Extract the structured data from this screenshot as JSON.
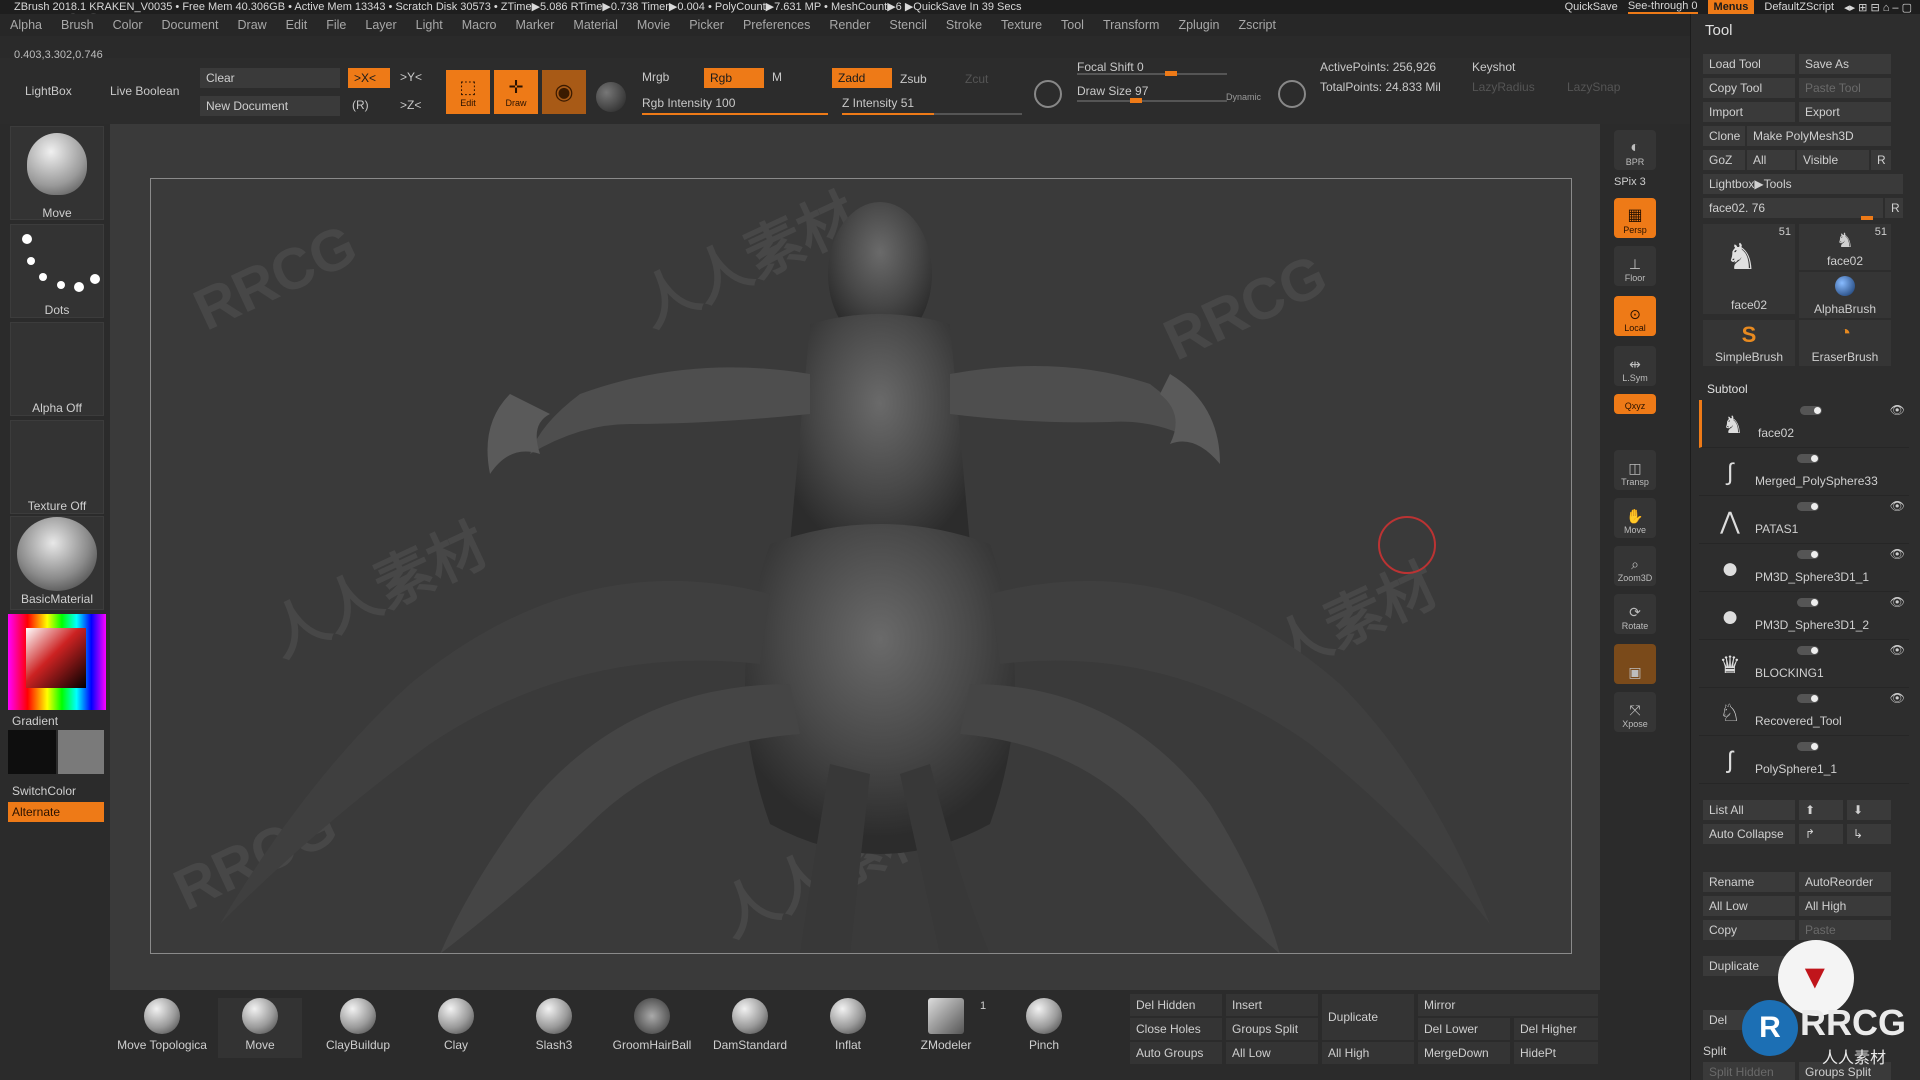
{
  "titlebar": {
    "text": "ZBrush 2018.1   KRAKEN_V0035   • Free Mem 40.306GB • Active Mem 13343 • Scratch Disk 30573 • ZTime▶5.086 RTime▶0.738 Timer▶0.004 • PolyCount▶7.631 MP • MeshCount▶6 ▶QuickSave In 39 Secs",
    "quicksave": "QuickSave",
    "seethrough": "See-through  0",
    "menus": "Menus",
    "script": "DefaultZScript"
  },
  "logo": "RRCG",
  "menubar": [
    "Alpha",
    "Brush",
    "Color",
    "Document",
    "Draw",
    "Edit",
    "File",
    "Layer",
    "Light",
    "Macro",
    "Marker",
    "Material",
    "Movie",
    "Picker",
    "Preferences",
    "Render",
    "Stencil",
    "Stroke",
    "Texture",
    "Tool",
    "Transform",
    "Zplugin",
    "Zscript"
  ],
  "coords": "0.403,3.302,0.746",
  "toolbar": {
    "lightbox": "LightBox",
    "live_boolean": "Live Boolean",
    "clear": "Clear",
    "new_document": "New Document",
    "x_sym": ">X<",
    "y_sym": ">Y<",
    "z_sym": ">Z<",
    "r_label": "(R)",
    "edit": "Edit",
    "draw": "Draw",
    "mrgb": "Mrgb",
    "rgb": "Rgb",
    "m": "M",
    "rgb_intensity": "Rgb Intensity 100",
    "zadd": "Zadd",
    "zsub": "Zsub",
    "zcut": "Zcut",
    "z_intensity": "Z Intensity 51",
    "focal_shift": "Focal Shift 0",
    "draw_size": "Draw Size 97",
    "dynamic": "Dynamic",
    "active_points": "ActivePoints: 256,926",
    "total_points": "TotalPoints: 24.833 Mil",
    "keyshot": "Keyshot",
    "lazy_radius": "LazyRadius",
    "lazy_snap": "LazySnap"
  },
  "toolbar_levels": {
    "rgb_intensity": 1.0,
    "z_intensity": 0.51
  },
  "leftshelf": {
    "move": "Move",
    "dots": "Dots",
    "alpha_off": "Alpha Off",
    "texture_off": "Texture Off",
    "material": "BasicMaterial",
    "gradient": "Gradient",
    "switchcolor": "SwitchColor",
    "alternate": "Alternate"
  },
  "watermarks": [
    "RRCG",
    "人人素材"
  ],
  "navshelf": {
    "bpr": "BPR",
    "spix": "SPix 3",
    "persp": "Persp",
    "floor": "Floor",
    "local": "Local",
    "lsym": "L.Sym",
    "xyz": "Qxyz",
    "transp": "Transp",
    "move": "Move",
    "zoom3d": "Zoom3D",
    "rotate": "Rotate",
    "xpose": "Xpose"
  },
  "palette": {
    "title": "Tool",
    "buttons": [
      [
        "Load Tool",
        "Save As"
      ],
      [
        "Copy Tool",
        "Paste Tool"
      ],
      [
        "Import",
        "Export"
      ],
      [
        "Clone",
        "Make PolyMesh3D"
      ],
      [
        "GoZ",
        "All",
        "Visible",
        "R"
      ]
    ],
    "lightbox_tools": "Lightbox▶Tools",
    "face_slider": "face02. 76",
    "face_r": "R",
    "thumbs": [
      {
        "label": "face02",
        "count": "51"
      },
      {
        "label": "face02",
        "count": "51"
      },
      {
        "label": "AlphaBrush",
        "count": ""
      },
      {
        "label": "SimpleBrush",
        "count": ""
      },
      {
        "label": "EraserBrush",
        "count": ""
      }
    ],
    "subtool_title": "Subtool",
    "subtools": [
      "face02",
      "Merged_PolySphere33",
      "PATAS1",
      "PM3D_Sphere3D1_1",
      "PM3D_Sphere3D1_2",
      "BLOCKING1",
      "Recovered_Tool",
      "PolySphere1_1"
    ],
    "list_all": "List All",
    "auto_collapse": "Auto Collapse",
    "rename": "Rename",
    "autoreorder": "AutoReorder",
    "all_low": "All Low",
    "all_high": "All High",
    "copy": "Copy",
    "paste": "Paste",
    "duplicate": "Duplicate",
    "split": "Split",
    "split_hidden": "Split Hidden",
    "groups_split": "Groups Split",
    "del": "Del"
  },
  "bottom": {
    "brushes": [
      "Move Topologica",
      "Move",
      "ClayBuildup",
      "Clay",
      "Slash3",
      "GroomHairBall",
      "DamStandard",
      "Inflat",
      "ZModeler",
      "Pinch"
    ],
    "zmodeler_count": "1",
    "buttons": [
      "Del Hidden",
      "Insert",
      "Duplicate",
      "Mirror",
      "Close Holes",
      "Groups Split",
      "Del Lower",
      "Del Higher",
      "Auto Groups",
      "All Low",
      "All High",
      "MergeDown",
      "HidePt"
    ]
  },
  "brand": {
    "text": "RRCG",
    "sub": "人人素材"
  }
}
